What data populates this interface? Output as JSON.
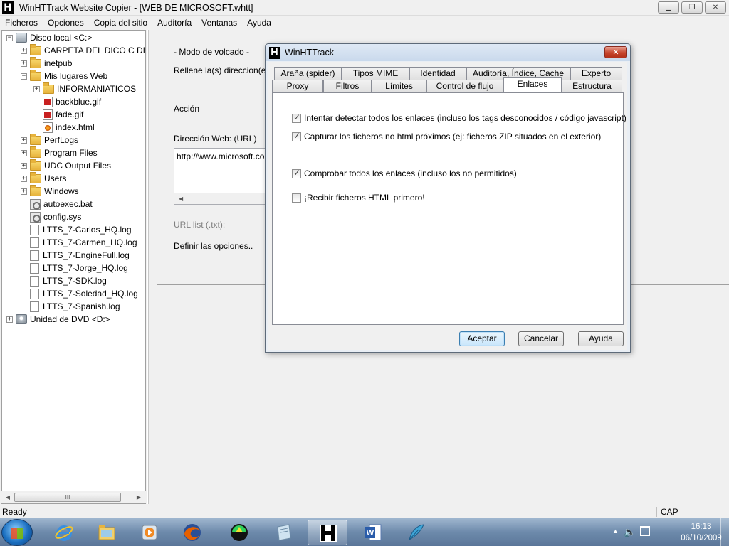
{
  "window": {
    "title": "WinHTTrack Website Copier - [WEB DE MICROSOFT.whtt]",
    "icon": "httrack-h-icon",
    "icon_letter": "H",
    "buttons": {
      "minimize": "▁",
      "maximize": "❐",
      "close": "✕"
    }
  },
  "menu": [
    "Ficheros",
    "Opciones",
    "Copia del sitio",
    "Auditoría",
    "Ventanas",
    "Ayuda"
  ],
  "tree": {
    "items": [
      {
        "label": "Disco local <C:>",
        "icon": "drive-icon",
        "expander": "−"
      },
      {
        "label": "CARPETA DEL DICO C DEL",
        "icon": "folder-icon",
        "expander": "+"
      },
      {
        "label": "inetpub",
        "icon": "folder-icon",
        "expander": "+"
      },
      {
        "label": "Mis lugares Web",
        "icon": "folder-icon",
        "expander": "−"
      },
      {
        "label": "INFORMANIATICOS",
        "icon": "folder-icon",
        "expander": "+"
      },
      {
        "label": "backblue.gif",
        "icon": "gif-file-icon",
        "expander": ""
      },
      {
        "label": "fade.gif",
        "icon": "gif-file-icon",
        "expander": ""
      },
      {
        "label": "index.html",
        "icon": "html-file-icon",
        "expander": ""
      },
      {
        "label": "PerfLogs",
        "icon": "folder-icon",
        "expander": "+"
      },
      {
        "label": "Program Files",
        "icon": "folder-icon",
        "expander": "+"
      },
      {
        "label": "UDC Output Files",
        "icon": "folder-icon",
        "expander": "+"
      },
      {
        "label": "Users",
        "icon": "folder-icon",
        "expander": "+"
      },
      {
        "label": "Windows",
        "icon": "folder-icon",
        "expander": "+"
      },
      {
        "label": "autoexec.bat",
        "icon": "bat-file-icon",
        "expander": ""
      },
      {
        "label": "config.sys",
        "icon": "sys-file-icon",
        "expander": ""
      },
      {
        "label": "LTTS_7-Carlos_HQ.log",
        "icon": "log-file-icon",
        "expander": ""
      },
      {
        "label": "LTTS_7-Carmen_HQ.log",
        "icon": "log-file-icon",
        "expander": ""
      },
      {
        "label": "LTTS_7-EngineFull.log",
        "icon": "log-file-icon",
        "expander": ""
      },
      {
        "label": "LTTS_7-Jorge_HQ.log",
        "icon": "log-file-icon",
        "expander": ""
      },
      {
        "label": "LTTS_7-SDK.log",
        "icon": "log-file-icon",
        "expander": ""
      },
      {
        "label": "LTTS_7-Soledad_HQ.log",
        "icon": "log-file-icon",
        "expander": ""
      },
      {
        "label": "LTTS_7-Spanish.log",
        "icon": "log-file-icon",
        "expander": ""
      },
      {
        "label": "Unidad de DVD <D:>",
        "icon": "dvd-drive-icon",
        "expander": "+"
      }
    ],
    "scroll_grip": "III"
  },
  "main": {
    "mode_label": "- Modo de volcado -",
    "fill_label": "Rellene la(s) direccion(es) e",
    "action_label": "Acción",
    "url_label": "Dirección Web: (URL)",
    "url_value": "http://www.microsoft.com/",
    "url_list_label": "URL list (.txt):",
    "define_label": "Definir las opciones.."
  },
  "dialog": {
    "title": "WinHTTrack",
    "close_glyph": "✕",
    "tabs_back": [
      "Araña (spider)",
      "Tipos MIME",
      "Identidad",
      "Auditoría, Índice, Cache",
      "Experto"
    ],
    "tabs_front": [
      "Proxy",
      "Filtros",
      "Límites",
      "Control de flujo",
      "Enlaces",
      "Estructura"
    ],
    "active_tab": "Enlaces",
    "options": [
      {
        "label": "Intentar detectar todos los enlaces (incluso los tags desconocidos / código javascript)",
        "checked": true
      },
      {
        "label": "Capturar los ficheros no html próximos (ej: ficheros ZIP situados en el exterior)",
        "checked": true
      },
      {
        "label": "Comprobar todos los enlaces (incluso los no permitidos)",
        "checked": true
      },
      {
        "label": "¡Recibir ficheros HTML primero!",
        "checked": false
      }
    ],
    "buttons": {
      "accept": "Aceptar",
      "cancel": "Cancelar",
      "help": "Ayuda"
    }
  },
  "status": {
    "text": "Ready",
    "caps": "CAP"
  },
  "taskbar": {
    "apps": [
      "internet-explorer-icon",
      "windows-explorer-icon",
      "media-player-icon",
      "firefox-icon",
      "app-icon",
      "notepad-icon",
      "httrack-icon",
      "word-icon",
      "feather-app-icon"
    ],
    "active_app": "httrack-icon",
    "clock_time": "16:13",
    "clock_date": "06/10/2009"
  },
  "colors": {
    "taskbar": "#5b7699",
    "dialog_border": "#5d6a79",
    "close_button": "#c6452c",
    "default_button": "#3c7fb1"
  }
}
